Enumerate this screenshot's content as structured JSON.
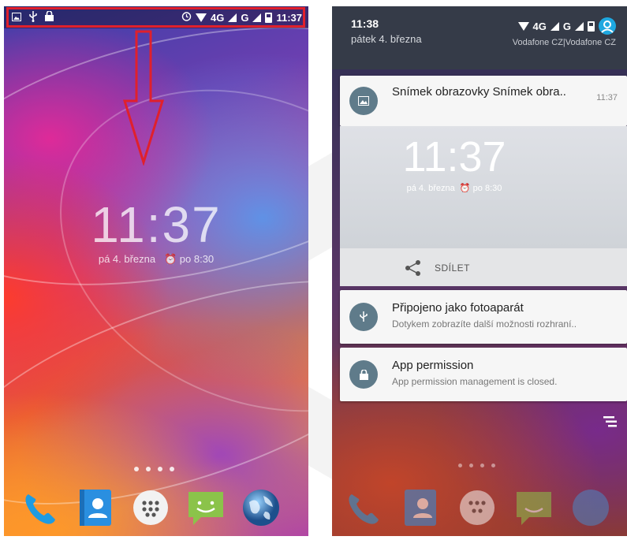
{
  "left_screen": {
    "status_bar": {
      "left_icons": [
        "screenshot-icon",
        "usb-icon",
        "lock-icon"
      ],
      "network": "4G",
      "network2": "G",
      "time": "11:37"
    },
    "lock_clock": {
      "time": "11:37",
      "date": "pá 4. března",
      "alarm": "po 8:30"
    },
    "page_dots": 4,
    "dock": [
      "phone-icon",
      "contacts-icon",
      "app-drawer-icon",
      "messaging-icon",
      "browser-globe-icon"
    ]
  },
  "right_screen": {
    "header": {
      "time": "11:38",
      "date": "pátek 4. března",
      "network": "4G",
      "network2": "G",
      "carrier": "Vodafone CZ|Vodafone CZ"
    },
    "notifications": [
      {
        "icon": "image-icon",
        "title": "Snímek obrazovky Snímek obra..",
        "time": "11:37",
        "preview_time": "11:37",
        "preview_date": "pá 4. března",
        "preview_alarm": "po 8:30",
        "action": "SDÍLET"
      },
      {
        "icon": "usb-icon",
        "title": "Připojeno jako fotoaparát",
        "text": "Dotykem zobrazíte další možnosti rozhraní.."
      },
      {
        "icon": "lock-icon",
        "title": "App permission",
        "text": "App permission management is closed."
      }
    ]
  },
  "colors": {
    "highlight": "#e0202c",
    "shade_header": "#353b48",
    "notification_icon": "#5f7b8a",
    "avatar": "#1ea8e0"
  }
}
